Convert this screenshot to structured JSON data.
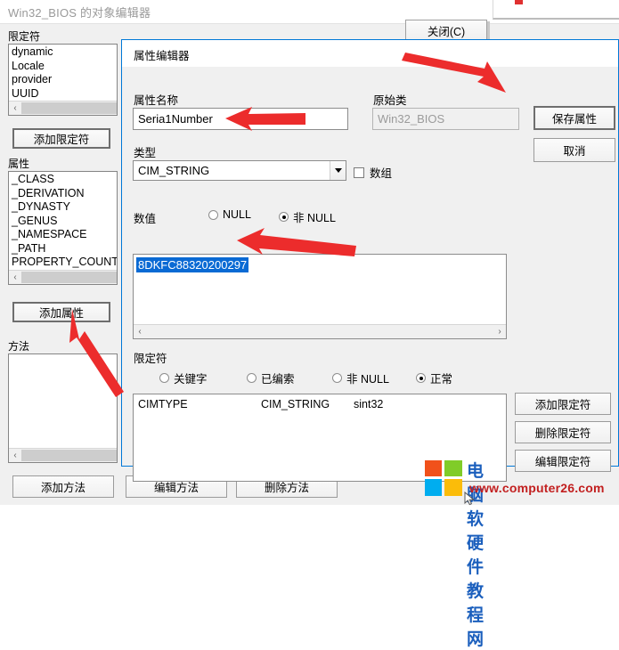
{
  "background_window": {
    "title": "Win32_BIOS 的对象编辑器",
    "close_button": "关闭(C)",
    "qualifiers_label": "限定符",
    "qualifiers_items": [
      "dynamic",
      "Locale",
      "provider",
      "UUID"
    ],
    "add_qualifier_button": "添加限定符",
    "properties_label": "属性",
    "properties_items": [
      "_CLASS",
      "_DERIVATION",
      "_DYNASTY",
      "_GENUS",
      "_NAMESPACE",
      "_PATH",
      "PROPERTY_COUNT"
    ],
    "add_property_button": "添加属性",
    "methods_label": "方法",
    "methods_items": [],
    "add_method_button": "添加方法",
    "edit_method_button": "编辑方法",
    "delete_method_button": "删除方法",
    "scroll_left_arrow": "‹",
    "scroll_right_arrow": "›"
  },
  "dialog": {
    "title": "属性编辑器",
    "property_name_label": "属性名称",
    "property_name_value": "Seria1Number",
    "origin_class_label": "原始类",
    "origin_class_value": "Win32_BIOS",
    "save_button": "保存属性",
    "cancel_button": "取消",
    "type_label": "类型",
    "type_value": "CIM_STRING",
    "array_checkbox_label": "数组",
    "array_checked": false,
    "value_label": "数值",
    "value_null_radio": "NULL",
    "value_notnull_radio": "非 NULL",
    "value_selected_radio": "non_null",
    "value_text": "8DKFC88320200297",
    "qualifiers_label": "限定符",
    "qual_filters": [
      {
        "label": "关键字",
        "selected": false
      },
      {
        "label": "已编索",
        "selected": false
      },
      {
        "label": "非 NULL",
        "selected": false
      },
      {
        "label": "正常",
        "selected": true
      }
    ],
    "qual_row": {
      "name": "CIMTYPE",
      "value": "CIM_STRING",
      "type": "sint32"
    },
    "add_qualifier_button": "添加限定符",
    "delete_qualifier_button": "删除限定符",
    "edit_qualifier_button": "编辑限定符",
    "scroll_left_arrow": "‹",
    "scroll_right_arrow": "›"
  },
  "annotations": {
    "arrow_count": 4,
    "arrow_color": "#ec2c2c",
    "targets": [
      "property-name-field",
      "save-property-button",
      "value-text",
      "add-property-button"
    ]
  },
  "watermark": {
    "site_name": "电脑软硬件教程网",
    "site_url": "www.computer26.com",
    "logo": "windows-logo"
  },
  "colors": {
    "dialog_border": "#0078d7",
    "selection_blue": "#0a6ad4",
    "arrow_red": "#ec2c2c",
    "watermark_blue": "#1b5fbd",
    "watermark_red": "#c22020",
    "window_bg": "#f0f0f0"
  }
}
